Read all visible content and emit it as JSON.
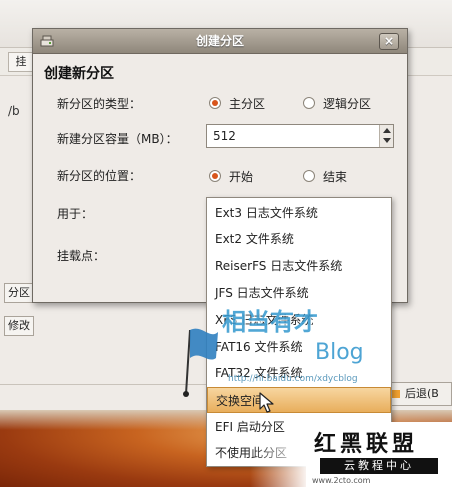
{
  "background": {
    "tab_label": "挂",
    "mount_path": "/b",
    "left_button_1": "分区",
    "left_button_2": "修改",
    "back_button": "后退(B"
  },
  "dialog": {
    "window_title": "创建分区",
    "close_symbol": "×",
    "heading": "创建新分区",
    "type_label": "新分区的类型：",
    "type_primary": "主分区",
    "type_logical": "逻辑分区",
    "size_label": "新建分区容量（MB）：",
    "size_value": "512",
    "position_label": "新分区的位置：",
    "position_begin": "开始",
    "position_end": "结束",
    "use_label": "用于：",
    "mount_label": "挂载点："
  },
  "dropdown": {
    "options": [
      "Ext3 日志文件系统",
      "Ext2 文件系统",
      "ReiserFS 日志文件系统",
      "JFS 日志文件系统",
      "XFS 日志文件系统",
      "FAT16 文件系统",
      "FAT32 文件系统",
      "交换空间",
      "EFI 启动分区",
      "不使用此分区"
    ],
    "selected": "交换空间"
  },
  "watermark": {
    "logo_text": "相当有才",
    "blog": "Blog",
    "url": "http://hi.baidu.com/xdycblog",
    "brand_title": "红黑联盟",
    "brand_subtitle": "云教程中心",
    "brand_url": "www.2cto.com"
  },
  "colors": {
    "radio_on": "#d8551c",
    "selection": "#e8ae5c",
    "titlebar": "#8f877b",
    "watermark_blue": "#3a9bd0"
  }
}
